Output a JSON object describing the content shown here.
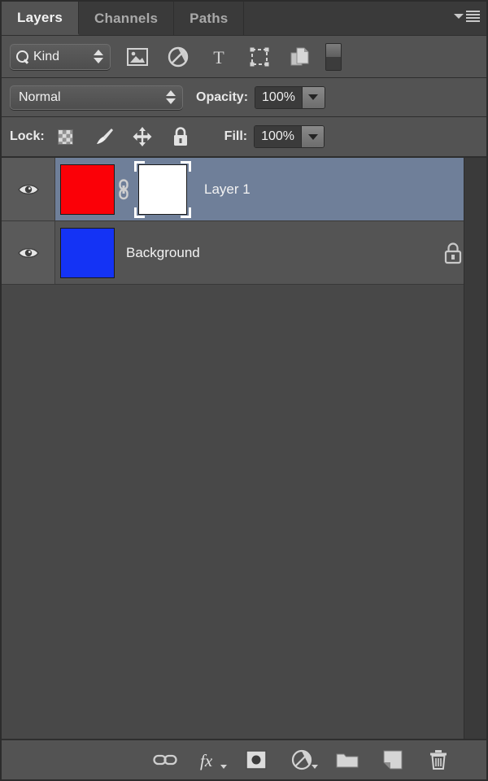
{
  "panel": {
    "tabs": [
      {
        "label": "Layers",
        "active": true
      },
      {
        "label": "Channels",
        "active": false
      },
      {
        "label": "Paths",
        "active": false
      }
    ],
    "menu_icon": "panel-menu-icon"
  },
  "filter": {
    "kind_label": "Kind",
    "search_icon": "magnifier-icon",
    "stepper_icon": "up-down-stepper-icon",
    "icons": [
      "pixel-layer-filter-icon",
      "adjustment-layer-filter-icon",
      "type-layer-filter-icon",
      "shape-layer-filter-icon",
      "smart-object-filter-icon"
    ],
    "toggle_icon": "filter-toggle-switch"
  },
  "blend": {
    "mode": "Normal",
    "opacity_label": "Opacity:",
    "opacity_value": "100%",
    "dropdown_icon": "chevron-down-icon"
  },
  "lock": {
    "label": "Lock:",
    "icons": [
      "lock-transparent-pixels-icon",
      "lock-image-pixels-icon",
      "lock-position-icon",
      "lock-all-icon"
    ],
    "fill_label": "Fill:",
    "fill_value": "100%"
  },
  "layers": [
    {
      "name": "Layer 1",
      "visible": true,
      "selected": true,
      "thumb_color": "#fb0007",
      "has_mask": true,
      "mask_color": "#ffffff",
      "mask_active": true,
      "linked": true,
      "locked": false
    },
    {
      "name": "Background",
      "visible": true,
      "selected": false,
      "thumb_color": "#1433f5",
      "has_mask": false,
      "linked": false,
      "locked": true
    }
  ],
  "bottom_toolbar": [
    "link-layers-icon",
    "layer-styles-fx-icon",
    "add-layer-mask-icon",
    "new-adjustment-layer-icon",
    "new-group-icon",
    "new-layer-icon",
    "delete-layer-icon"
  ],
  "colors": {
    "panel_bg": "#484848",
    "chrome_bg": "#535353",
    "tab_inactive_bg": "#3a3a3a",
    "row_bg": "#545454",
    "row_selected_bg": "#6f7f99",
    "eye_column_bg": "#5a5a5a",
    "text": "#f2f2f2",
    "text_dim": "#a9a9a9",
    "icon": "#d2d2d2"
  }
}
